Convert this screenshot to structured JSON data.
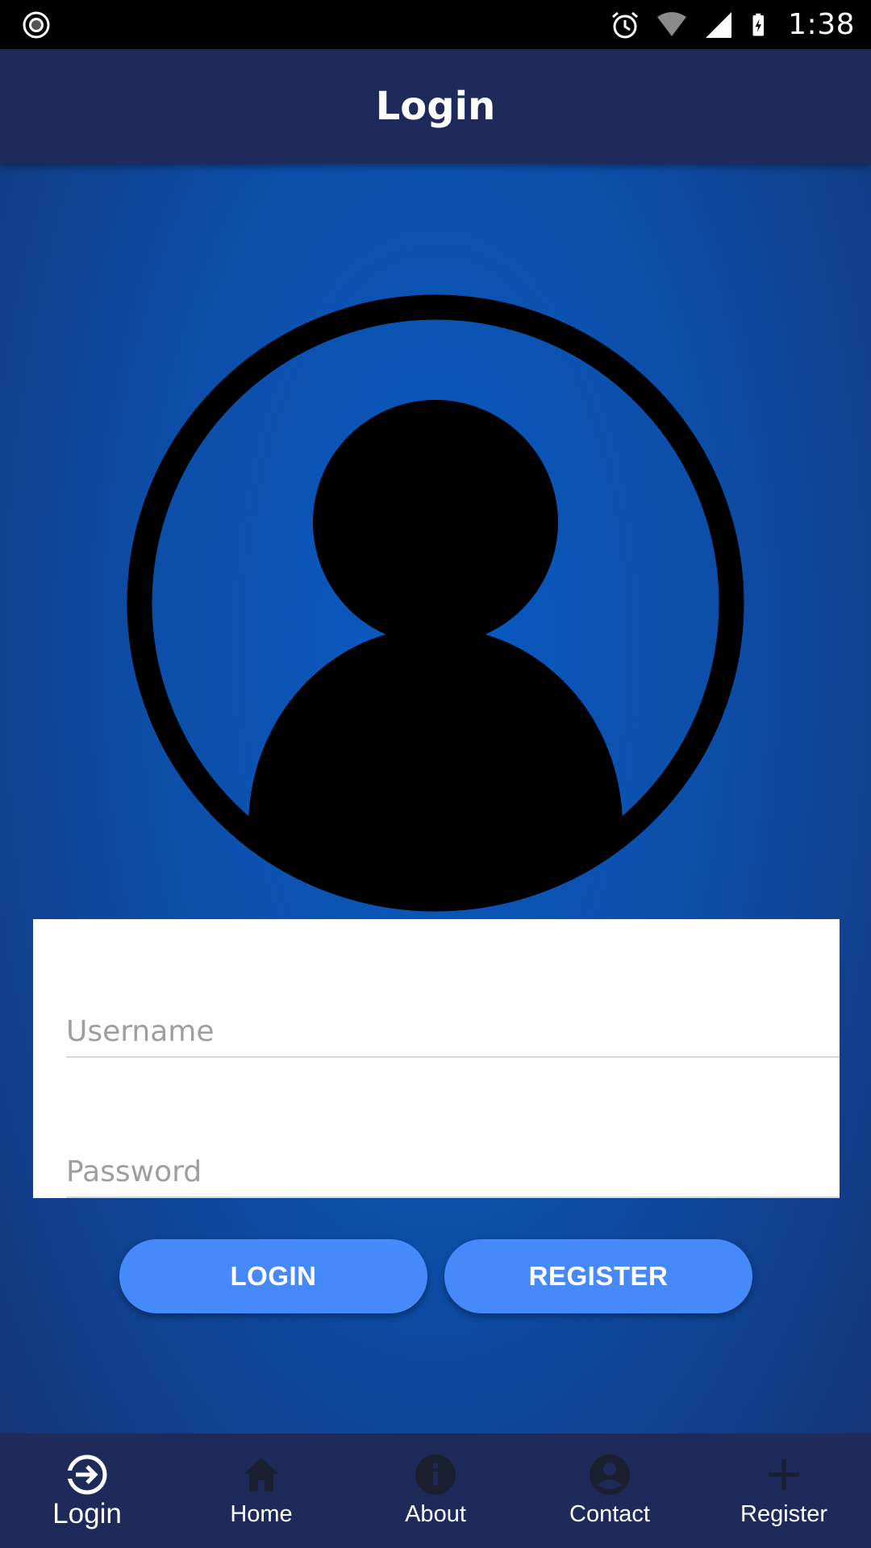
{
  "status_bar": {
    "time": "1:38",
    "icons": [
      "record-icon",
      "alarm-icon",
      "wifi-icon",
      "signal-icon",
      "battery-charging-icon"
    ]
  },
  "app_bar": {
    "title": "Login"
  },
  "form": {
    "username": {
      "placeholder": "Username",
      "value": ""
    },
    "password": {
      "placeholder": "Password",
      "value": ""
    }
  },
  "buttons": {
    "login_label": "LOGIN",
    "register_label": "REGISTER"
  },
  "bottom_nav": {
    "items": [
      {
        "label": "Login",
        "icon": "login-icon",
        "active": true
      },
      {
        "label": "Home",
        "icon": "home-icon",
        "active": false
      },
      {
        "label": "About",
        "icon": "info-icon",
        "active": false
      },
      {
        "label": "Contact",
        "icon": "account-circle-icon",
        "active": false
      },
      {
        "label": "Register",
        "icon": "plus-icon",
        "active": false
      }
    ]
  },
  "colors": {
    "app_bar": "#1d2a5a",
    "button": "#4589fb",
    "background_center": "#0a5bc4",
    "inactive_icon": "#1b2030"
  }
}
